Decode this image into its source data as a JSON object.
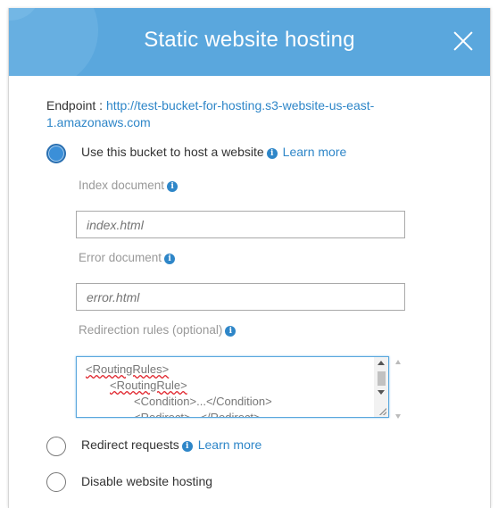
{
  "dialog": {
    "title": "Static website hosting",
    "close_icon": "close-icon"
  },
  "endpoint": {
    "label": "Endpoint : ",
    "url": "http://test-bucket-for-hosting.s3-website-us-east-1.amazonaws.com"
  },
  "options": {
    "host": {
      "label": "Use this bucket to host a website",
      "learn_more": "Learn more",
      "selected": true
    },
    "redirect": {
      "label": "Redirect requests",
      "learn_more": "Learn more",
      "selected": false
    },
    "disable": {
      "label": "Disable website hosting",
      "selected": false
    }
  },
  "fields": {
    "index": {
      "label": "Index document",
      "placeholder": "index.html"
    },
    "error": {
      "label": "Error document",
      "placeholder": "error.html"
    },
    "rules": {
      "label": "Redirection rules (optional)",
      "lines": [
        "<RoutingRules>",
        "<RoutingRule>",
        "<Condition>...</Condition>",
        "<Redirect>...</Redirect>"
      ]
    }
  },
  "colors": {
    "header": "#5aa7dd",
    "accent": "#2e86c8"
  }
}
